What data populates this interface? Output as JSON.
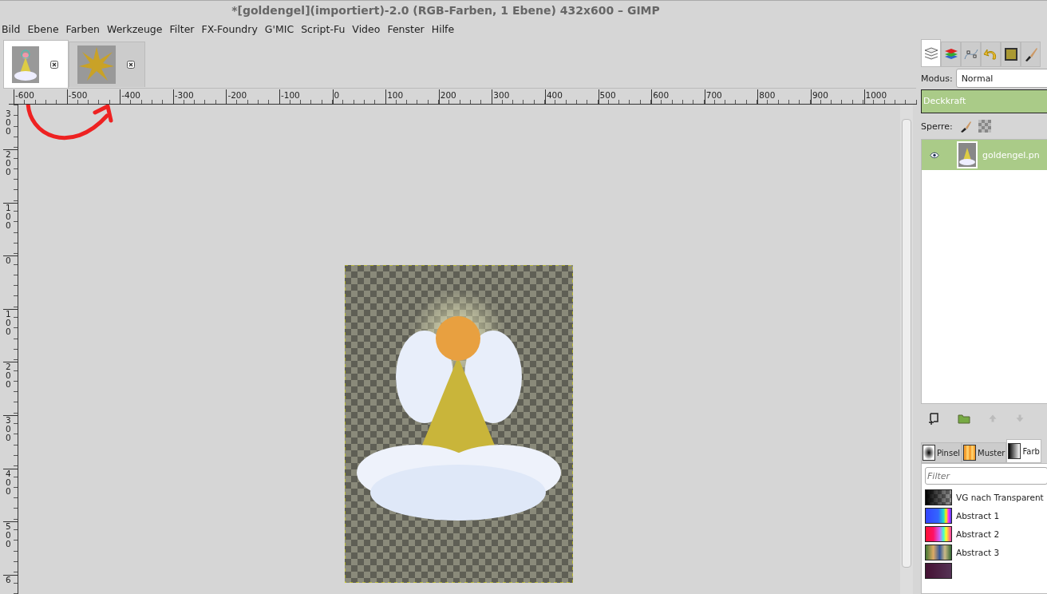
{
  "window": {
    "title": "*[goldengel](importiert)-2.0 (RGB-Farben, 1 Ebene) 432x600 – GIMP"
  },
  "menu": [
    "Bild",
    "Ebene",
    "Farben",
    "Werkzeuge",
    "Filter",
    "FX-Foundry",
    "G'MIC",
    "Script-Fu",
    "Video",
    "Fenster",
    "Hilfe"
  ],
  "image_tabs": [
    {
      "kind": "angel",
      "selected": true
    },
    {
      "kind": "star",
      "selected": false
    }
  ],
  "horizontal_ruler": [
    "-600",
    "-500",
    "-400",
    "-300",
    "-200",
    "-100",
    "0",
    "100",
    "200",
    "300",
    "400",
    "500",
    "600",
    "700",
    "800",
    "900",
    "1000"
  ],
  "vertical_ruler": [
    "300",
    "200",
    "100",
    "0",
    "100",
    "200",
    "300",
    "400",
    "500",
    "6"
  ],
  "dock": {
    "tabs": [
      {
        "kind": "layers",
        "selected": true
      },
      {
        "kind": "channels",
        "selected": false
      },
      {
        "kind": "paths",
        "selected": false
      },
      {
        "kind": "undo",
        "selected": false
      },
      {
        "kind": "image",
        "selected": false
      },
      {
        "kind": "brush",
        "selected": false
      }
    ],
    "mode_label": "Modus:",
    "mode_value": "Normal",
    "opacity": {
      "label": "Deckkraft",
      "level": 1
    },
    "lock_label": "Sperre:",
    "layers": [
      {
        "name": "goldengel.pn",
        "visible": true,
        "selected": true
      }
    ],
    "resource_tabs": [
      {
        "kind": "brush",
        "label": "Pinsel",
        "selected": false
      },
      {
        "kind": "pattern",
        "label": "Muster",
        "selected": false
      },
      {
        "kind": "gradient",
        "label": "Farb",
        "selected": true
      }
    ],
    "filter_placeholder": "Filter",
    "gradients": [
      {
        "kind": "fg-transparent",
        "name": "VG nach Transparent"
      },
      {
        "kind": "abstract1",
        "name": "Abstract 1"
      },
      {
        "kind": "abstract2",
        "name": "Abstract 2"
      },
      {
        "kind": "abstract3",
        "name": "Abstract 3"
      },
      {
        "kind": "dark"
      }
    ]
  }
}
